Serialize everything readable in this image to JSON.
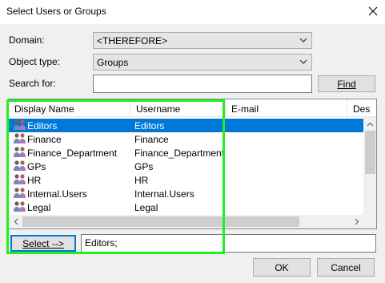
{
  "window": {
    "title": "Select Users or Groups"
  },
  "domain": {
    "label": "Domain:",
    "value": "<THEREFORE>"
  },
  "object_type": {
    "label": "Object type:",
    "value": "Groups"
  },
  "search": {
    "label": "Search for:",
    "value": "",
    "find_label": "Find"
  },
  "list": {
    "columns": [
      "Display Name",
      "Username",
      "E-mail",
      "Des"
    ],
    "rows": [
      {
        "display_name": "Editors",
        "username": "Editors",
        "selected": true
      },
      {
        "display_name": "Finance",
        "username": "Finance",
        "selected": false
      },
      {
        "display_name": "Finance_Department",
        "username": "Finance_Department",
        "selected": false
      },
      {
        "display_name": "GPs",
        "username": "GPs",
        "selected": false
      },
      {
        "display_name": "HR",
        "username": "HR",
        "selected": false
      },
      {
        "display_name": "Internal.Users",
        "username": "Internal.Users",
        "selected": false
      },
      {
        "display_name": "Legal",
        "username": "Legal",
        "selected": false
      }
    ]
  },
  "select": {
    "button_label": "Select -->",
    "value": "Editors;"
  },
  "footer": {
    "ok_label": "OK",
    "cancel_label": "Cancel"
  },
  "colors": {
    "selection": "#0078d7",
    "highlight_box": "#22ee22"
  }
}
